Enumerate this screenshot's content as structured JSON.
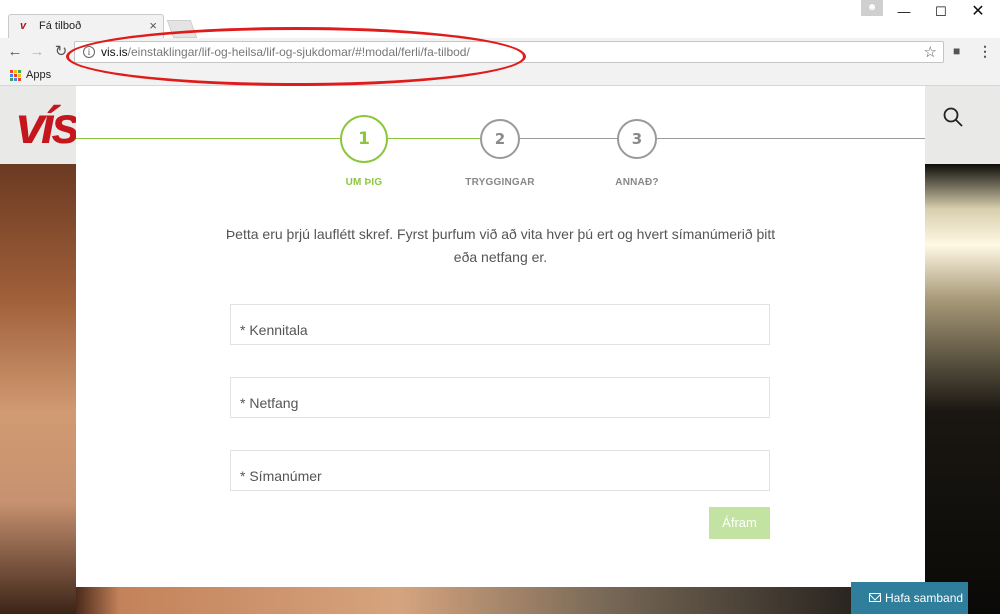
{
  "browser": {
    "tab_title": "Fá tilboð",
    "url_host": "vis.is",
    "url_path": "/einstaklingar/lif-og-heilsa/lif-og-sjukdomar/#!modal/ferli/fa-tilbod/",
    "bookmarks": {
      "apps_label": "Apps"
    }
  },
  "site": {
    "logo_text": "vís"
  },
  "modal": {
    "steps": [
      {
        "number": "1",
        "label": "UM ÞIG"
      },
      {
        "number": "2",
        "label": "TRYGGINGAR"
      },
      {
        "number": "3",
        "label": "ANNAÐ?"
      }
    ],
    "intro_text": "Þetta eru þrjú lauflétt skref. Fyrst þurfum við að vita hver þú ert og hvert símanúmerið þitt eða netfang er.",
    "fields": [
      {
        "placeholder": "* Kennitala",
        "value": ""
      },
      {
        "placeholder": "* Netfang",
        "value": ""
      },
      {
        "placeholder": "* Símanúmer",
        "value": ""
      }
    ],
    "next_button": "Áfram"
  },
  "contact_button": "Hafa samband",
  "colors": {
    "accent_green": "#8cc63f",
    "disabled_button": "#c3e3a3",
    "brand_red": "#c4161c",
    "contact_blue": "#2f7e9c",
    "annotation_red": "#e01b1b"
  }
}
